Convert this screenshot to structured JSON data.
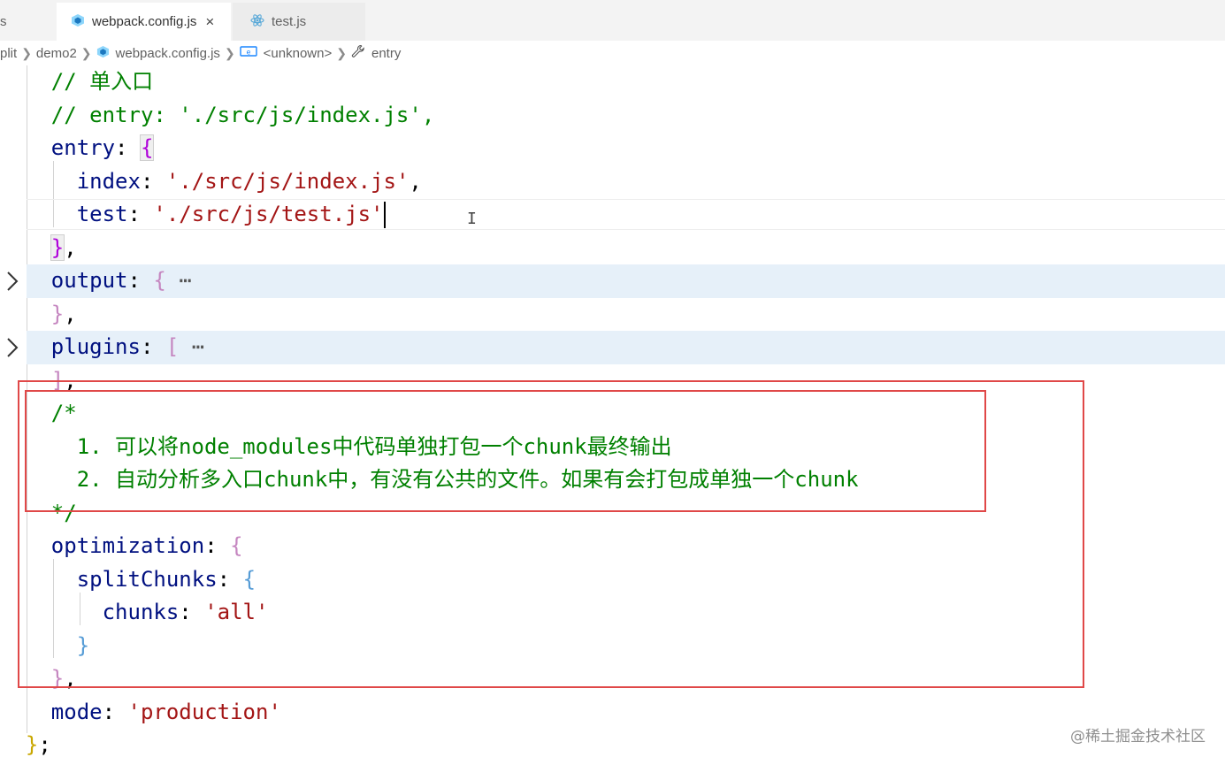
{
  "tabs": [
    {
      "label": "s",
      "active": false
    },
    {
      "label": "webpack.config.js",
      "active": true,
      "icon": "webpack-cube-icon",
      "close": "×"
    },
    {
      "label": "test.js",
      "active": false,
      "icon": "react-atom-icon"
    }
  ],
  "breadcrumb": {
    "items": [
      "plit",
      "demo2",
      "webpack.config.js",
      "<unknown>",
      "entry"
    ],
    "icons": [
      "webpack-cube-icon",
      "variable-icon",
      "wrench-icon"
    ]
  },
  "code": {
    "l1_comment": "// 单入口",
    "l2_comment": "// entry: './src/js/index.js',",
    "entry_key": "entry",
    "index_key": "index",
    "index_val": "'./src/js/index.js'",
    "test_key": "test",
    "test_val": "'./src/js/test.js'",
    "output_key": "output",
    "plugins_key": "plugins",
    "ellipsis": "⋯",
    "comment_open": "/*",
    "comment_line1": "1. 可以将node_modules中代码单独打包一个chunk最终输出",
    "comment_line2": "2. 自动分析多入口chunk中，有没有公共的文件。如果有会打包成单独一个chunk",
    "comment_close": "*/",
    "optimization_key": "optimization",
    "splitchunks_key": "splitChunks",
    "chunks_key": "chunks",
    "chunks_val": "'all'",
    "mode_key": "mode",
    "mode_val": "'production'"
  },
  "watermark": "@稀土掘金技术社区",
  "colors": {
    "keyword": "#001080",
    "string": "#a31515",
    "comment": "#008000",
    "annotation_box": "#e04848",
    "folded_bg": "#e6f0f9"
  }
}
